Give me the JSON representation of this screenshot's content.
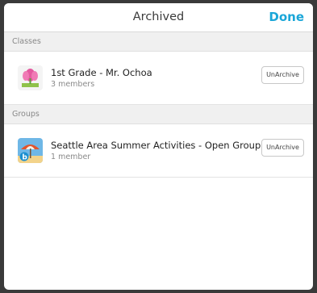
{
  "header": {
    "title": "Archived",
    "done_label": "Done"
  },
  "sections": [
    {
      "label": "Classes",
      "items": [
        {
          "title": "1st Grade - Mr. Ochoa",
          "subtitle": "3 members",
          "button_label": "UnArchive",
          "icon": "flower-class-icon"
        }
      ]
    },
    {
      "label": "Groups",
      "items": [
        {
          "title": "Seattle Area Summer Activities - Open Group",
          "subtitle": "1 member",
          "button_label": "UnArchive",
          "icon": "beach-group-icon"
        }
      ]
    }
  ],
  "colors": {
    "accent": "#1aa6d8",
    "section_bg": "#f0f0f0"
  }
}
